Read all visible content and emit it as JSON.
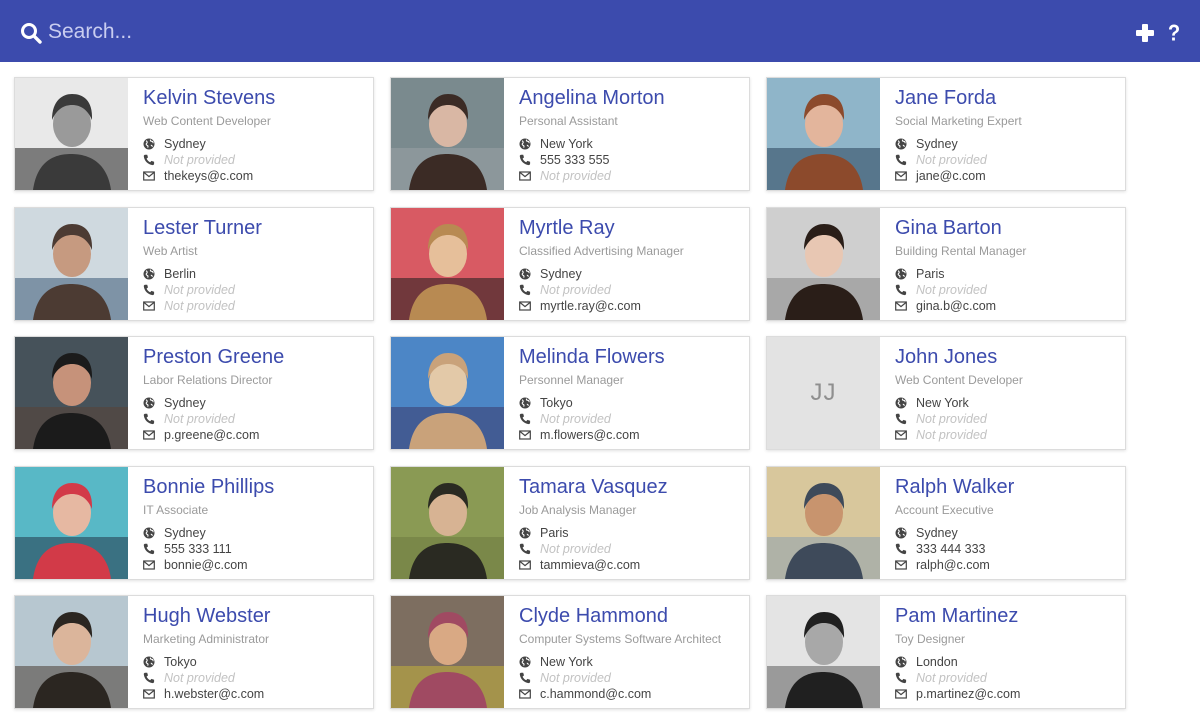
{
  "search": {
    "placeholder": "Search..."
  },
  "actions": {
    "add": "add-icon",
    "help": "help-icon"
  },
  "colors": {
    "accent": "#3c4bad",
    "placeholder": "#c2c2c2"
  },
  "contacts": [
    {
      "name": "Kelvin Stevens",
      "title": "Web Content Developer",
      "city": "Sydney",
      "phone": "Not provided",
      "email": "thekeys@c.com"
    },
    {
      "name": "Angelina Morton",
      "title": "Personal Assistant",
      "city": "New York",
      "phone": "555 333 555",
      "email": "Not provided"
    },
    {
      "name": "Jane Forda",
      "title": "Social Marketing Expert",
      "city": "Sydney",
      "phone": "Not provided",
      "email": "jane@c.com"
    },
    {
      "name": "Lester Turner",
      "title": "Web Artist",
      "city": "Berlin",
      "phone": "Not provided",
      "email": "Not provided"
    },
    {
      "name": "Myrtle Ray",
      "title": "Classified Advertising Manager",
      "city": "Sydney",
      "phone": "Not provided",
      "email": "myrtle.ray@c.com"
    },
    {
      "name": "Gina Barton",
      "title": "Building Rental Manager",
      "city": "Paris",
      "phone": "Not provided",
      "email": "gina.b@c.com"
    },
    {
      "name": "Preston Greene",
      "title": "Labor Relations Director",
      "city": "Sydney",
      "phone": "Not provided",
      "email": "p.greene@c.com"
    },
    {
      "name": "Melinda Flowers",
      "title": "Personnel Manager",
      "city": "Tokyo",
      "phone": "Not provided",
      "email": "m.flowers@c.com"
    },
    {
      "name": "John Jones",
      "title": "Web Content Developer",
      "city": "New York",
      "phone": "Not provided",
      "email": "Not provided",
      "initials": "JJ"
    },
    {
      "name": "Bonnie Phillips",
      "title": "IT Associate",
      "city": "Sydney",
      "phone": "555 333 111",
      "email": "bonnie@c.com"
    },
    {
      "name": "Tamara Vasquez",
      "title": "Job Analysis Manager",
      "city": "Paris",
      "phone": "Not provided",
      "email": "tammieva@c.com"
    },
    {
      "name": "Ralph Walker",
      "title": "Account Executive",
      "city": "Sydney",
      "phone": "333 444 333",
      "email": "ralph@c.com"
    },
    {
      "name": "Hugh Webster",
      "title": "Marketing Administrator",
      "city": "Tokyo",
      "phone": "Not provided",
      "email": "h.webster@c.com"
    },
    {
      "name": "Clyde Hammond",
      "title": "Computer Systems Software Architect",
      "city": "New York",
      "phone": "Not provided",
      "email": "c.hammond@c.com"
    },
    {
      "name": "Pam Martinez",
      "title": "Toy Designer",
      "city": "London",
      "phone": "Not provided",
      "email": "p.martinez@c.com"
    }
  ]
}
